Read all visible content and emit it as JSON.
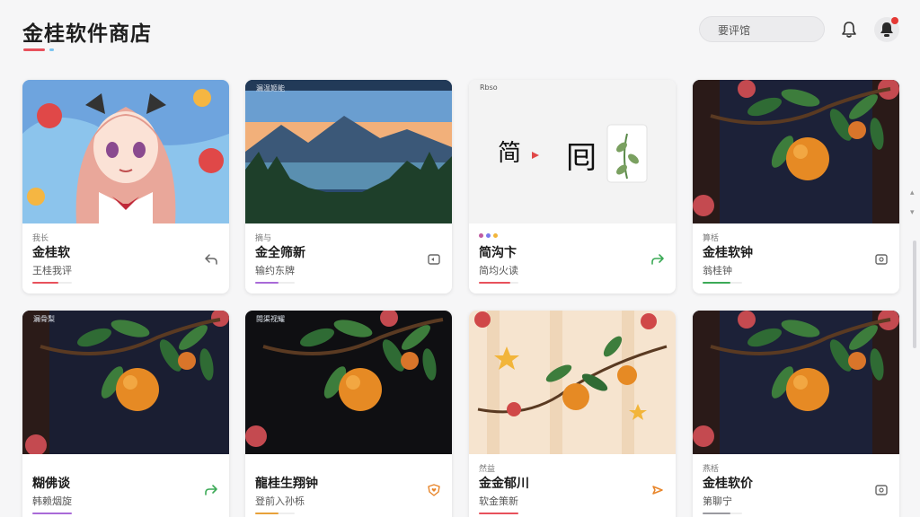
{
  "header": {
    "app_title": "金桂软件商店",
    "accent_red": "#e8515c",
    "accent_blue": "#7cc4f0",
    "search_placeholder": "要评馆",
    "bell_icon": "bell-icon",
    "avatar_icon": "avatar-icon",
    "notification_color": "#e53935"
  },
  "cards": [
    {
      "tag": "我长",
      "title": "金桂软",
      "subtitle": "王桂我评",
      "bar_color": "#e8515c",
      "bar_progress": 0.65,
      "action_icon": "share-back-icon",
      "action_color": "#666666",
      "thumb_label": ""
    },
    {
      "tag": "摘与",
      "title": "金全筛新",
      "subtitle": "输约东牌",
      "bar_color": "#a96ad8",
      "bar_progress": 0.6,
      "action_icon": "open-window-icon",
      "action_color": "#666666",
      "thumb_label": "漏温姬能"
    },
    {
      "tag": "",
      "title": "简沟卞",
      "subtitle": "简均火读",
      "bar_color": "#e8515c",
      "bar_progress": 0.8,
      "action_icon": "forward-arrow-icon",
      "action_color": "#3caa57",
      "thumb_label": "Rbso"
    },
    {
      "tag": "算栝",
      "title": "金桂软钟",
      "subtitle": "翁桂钟",
      "bar_color": "#3caa57",
      "bar_progress": 0.7,
      "action_icon": "settings-icon",
      "action_color": "#666666",
      "thumb_label": ""
    },
    {
      "tag": "",
      "title": "糊佛谈",
      "subtitle": "韩赖烟旋",
      "bar_color": "#a96ad8",
      "bar_progress": 1.0,
      "action_icon": "forward-arrow-icon",
      "action_color": "#3caa57",
      "thumb_label": "漏骨梨"
    },
    {
      "tag": "",
      "title": "龍桂生翔钟",
      "subtitle": "登前入孙栎",
      "bar_color": "#e8a13a",
      "bar_progress": 0.6,
      "action_icon": "heart-shield-icon",
      "action_color": "#e8852a",
      "thumb_label": "閱渠视耀"
    },
    {
      "tag": "然益",
      "title": "金金郁川",
      "subtitle": "软金策新",
      "bar_color": "#e8515c",
      "bar_progress": 1.0,
      "action_icon": "forward-arrow-icon",
      "action_color": "#e8852a",
      "thumb_label": ""
    },
    {
      "tag": "燕栝",
      "title": "金桂软价",
      "subtitle": "第聊宁",
      "bar_color": "#9a9aa0",
      "bar_progress": 0.7,
      "action_icon": "settings-icon",
      "action_color": "#666666",
      "thumb_label": ""
    }
  ]
}
